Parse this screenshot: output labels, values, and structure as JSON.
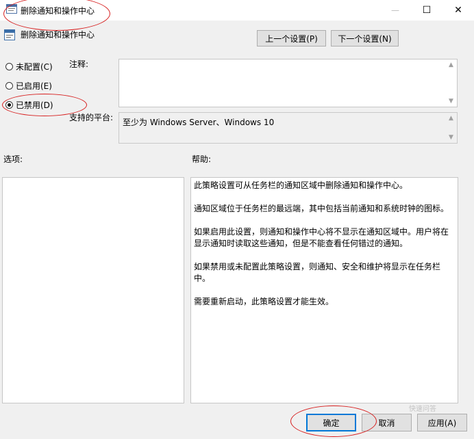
{
  "window": {
    "title": "删除通知和操作中心",
    "controls": {
      "minimize": "—",
      "maximize": "☐",
      "close": "✕"
    }
  },
  "policy": {
    "name": "删除通知和操作中心"
  },
  "nav": {
    "prev": "上一个设置(P)",
    "next": "下一个设置(N)"
  },
  "state_options": [
    {
      "label": "未配置(C)",
      "checked": false
    },
    {
      "label": "已启用(E)",
      "checked": false
    },
    {
      "label": "已禁用(D)",
      "checked": true
    }
  ],
  "labels": {
    "comment": "注释:",
    "supported_on": "支持的平台:",
    "options": "选项:",
    "help": "帮助:"
  },
  "comment_value": "",
  "supported_platform": "至少为 Windows Server、Windows 10",
  "help_text": [
    "此策略设置可从任务栏的通知区域中删除通知和操作中心。",
    "通知区域位于任务栏的最远端，其中包括当前通知和系统时钟的图标。",
    "如果启用此设置，则通知和操作中心将不显示在通知区域中。用户将在显示通知时读取这些通知，但是不能查看任何错过的通知。",
    "如果禁用或未配置此策略设置，则通知、安全和维护将显示在任务栏中。",
    "需要重新启动，此策略设置才能生效。"
  ],
  "buttons": {
    "ok": "确定",
    "cancel": "取消",
    "apply": "应用(A)"
  },
  "watermark": "快速问答",
  "colors": {
    "accent": "#0078d7",
    "annotation": "#d71f1f"
  }
}
